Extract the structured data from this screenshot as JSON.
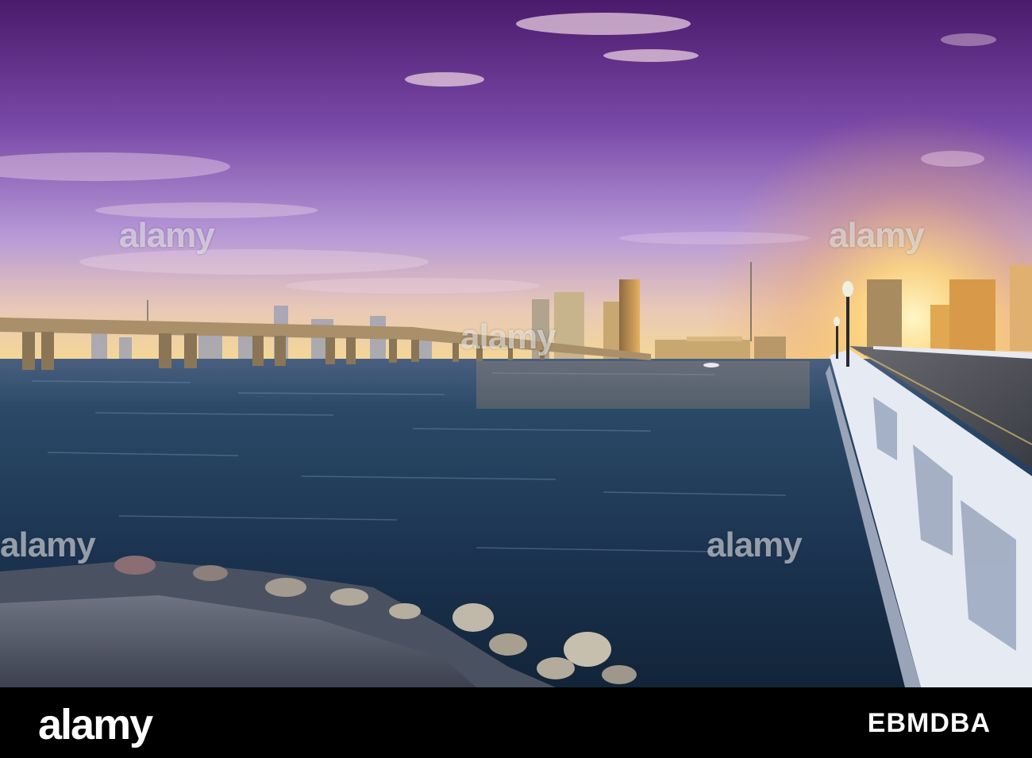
{
  "watermark": {
    "text": "alamy"
  },
  "footer": {
    "logo_text": "alamy",
    "image_id": "EBMDBA"
  },
  "colors": {
    "sky_top": "#5a1f7a",
    "sky_mid": "#9a6ec4",
    "sky_horizon": "#f8d98a",
    "water_dark": "#16324a",
    "water_mid": "#2e5a7a",
    "footer_bg": "#000000"
  }
}
